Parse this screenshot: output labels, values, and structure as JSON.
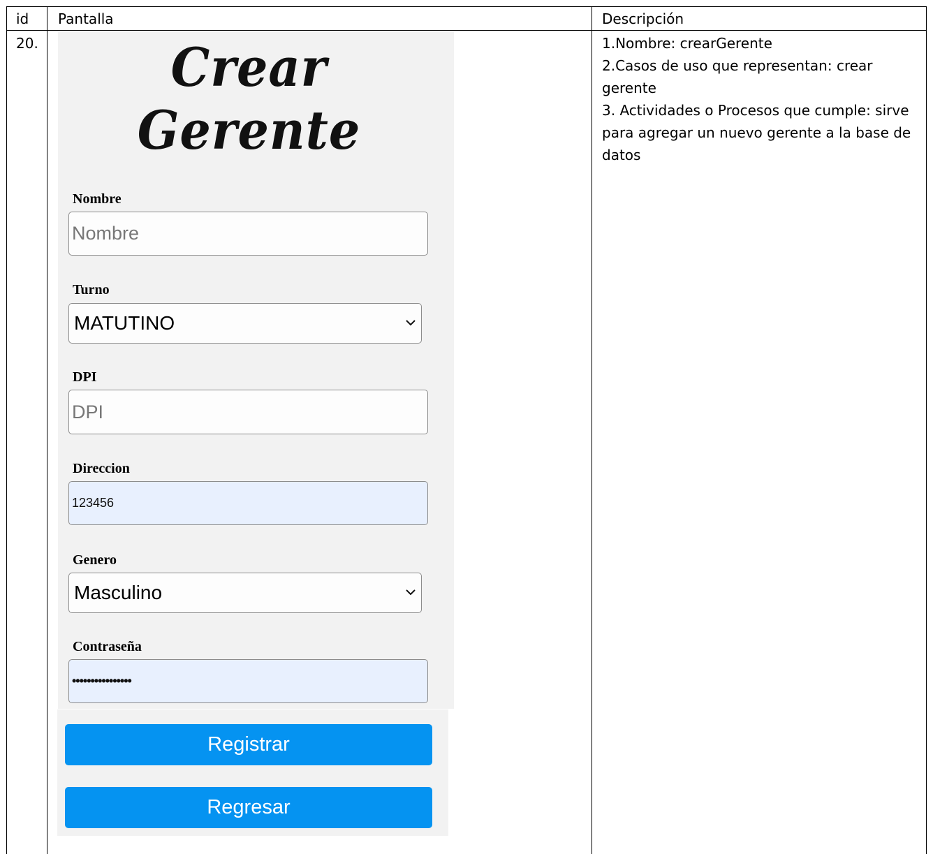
{
  "table": {
    "headers": {
      "id": "id",
      "pantalla": "Pantalla",
      "descripcion": "Descripción"
    },
    "row": {
      "id": "20.",
      "descripcion": "1.Nombre: crearGerente\n2.Casos de uso que representan: crear gerente\n3. Actividades o Procesos que cumple: sirve para agregar un nuevo gerente a la base de datos"
    }
  },
  "screen": {
    "title": "Crear Gerente",
    "fields": {
      "nombre": {
        "label": "Nombre",
        "placeholder": "Nombre"
      },
      "turno": {
        "label": "Turno",
        "selected": "MATUTINO"
      },
      "dpi": {
        "label": "DPI",
        "placeholder": "DPI"
      },
      "direccion": {
        "label": "Direccion",
        "value": "123456"
      },
      "genero": {
        "label": "Genero",
        "selected": "Masculino"
      },
      "contrasena": {
        "label": "Contraseña",
        "value": "••••••••••••••••"
      }
    },
    "buttons": {
      "registrar": "Registrar",
      "regresar": "Regresar"
    }
  },
  "colors": {
    "button": "#0593f1",
    "autofill": "#e8f0fe",
    "panel": "#f2f2f2"
  },
  "icons": {
    "select_arrow": "chevron-down-icon"
  }
}
